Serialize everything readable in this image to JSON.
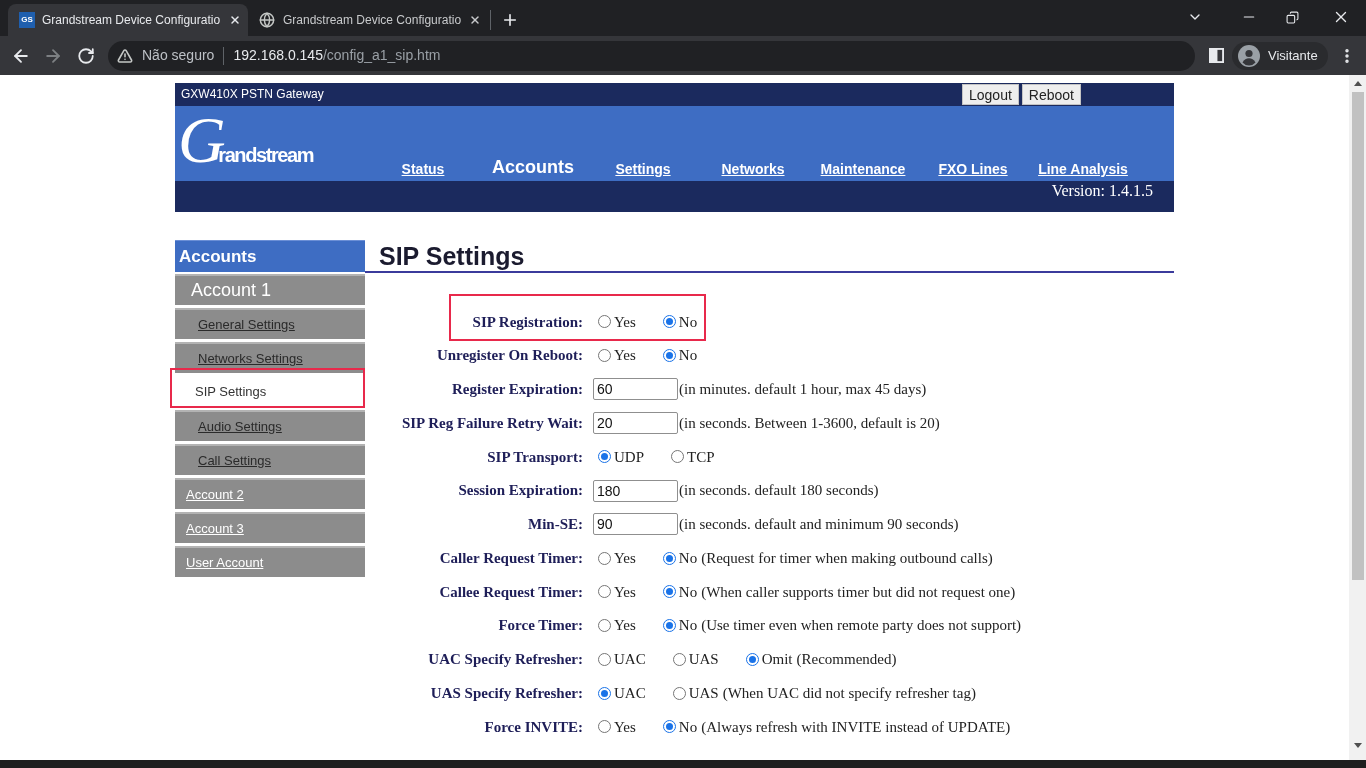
{
  "browser": {
    "tabs": [
      {
        "kind": "gs",
        "favicon_text": "GS",
        "title": "Grandstream Device Configuratio",
        "selected": true
      },
      {
        "kind": "globe",
        "title": "Grandstream Device Configuratio",
        "selected": false
      }
    ],
    "address_bar": {
      "security_label": "Não seguro",
      "host": "192.168.0.145",
      "path": "/config_a1_sip.htm"
    },
    "profile": {
      "label": "Visitante"
    }
  },
  "header": {
    "product": "GXW410X PSTN Gateway",
    "buttons": [
      "Logout",
      "Reboot"
    ],
    "logo": "Grandstream",
    "nav": [
      {
        "label": "Status",
        "selected": false
      },
      {
        "label": "Accounts",
        "selected": true
      },
      {
        "label": "Settings",
        "selected": false
      },
      {
        "label": "Networks",
        "selected": false
      },
      {
        "label": "Maintenance",
        "selected": false
      },
      {
        "label": "FXO Lines",
        "selected": false
      },
      {
        "label": "Line Analysis",
        "selected": false
      }
    ],
    "version": "Version: 1.4.1.5"
  },
  "sidebar": {
    "title": "Accounts",
    "items": [
      {
        "label": "Account 1",
        "expanded": true,
        "children": [
          {
            "label": "General Settings",
            "selected": false,
            "highlighted": false
          },
          {
            "label": "Networks Settings",
            "selected": false,
            "highlighted": false
          },
          {
            "label": "SIP Settings",
            "selected": true,
            "highlighted": true
          },
          {
            "label": "Audio Settings",
            "selected": false,
            "highlighted": false
          },
          {
            "label": "Call Settings",
            "selected": false,
            "highlighted": false
          }
        ]
      },
      {
        "label": "Account 2",
        "expanded": false
      },
      {
        "label": "Account 3",
        "expanded": false
      },
      {
        "label": "User Account",
        "expanded": false
      }
    ]
  },
  "main": {
    "title": "SIP Settings",
    "rows": [
      {
        "kind": "radio",
        "label": "SIP Registration:",
        "highlighted": true,
        "options": [
          {
            "label": "Yes",
            "selected": false
          },
          {
            "label": "No",
            "selected": true
          }
        ]
      },
      {
        "kind": "radio",
        "label": "Unregister On Reboot:",
        "highlighted": false,
        "options": [
          {
            "label": "Yes",
            "selected": false
          },
          {
            "label": "No",
            "selected": true
          }
        ]
      },
      {
        "kind": "text",
        "label": "Register Expiration:",
        "highlighted": false,
        "value": "60",
        "note": "(in minutes. default 1 hour, max 45 days)"
      },
      {
        "kind": "text",
        "label": "SIP Reg Failure Retry Wait:",
        "highlighted": false,
        "value": "20",
        "note": "(in seconds. Between 1-3600, default is 20)"
      },
      {
        "kind": "radio",
        "label": "SIP Transport:",
        "highlighted": false,
        "options": [
          {
            "label": "UDP",
            "selected": true
          },
          {
            "label": "TCP",
            "selected": false
          }
        ]
      },
      {
        "kind": "text",
        "label": "Session Expiration:",
        "highlighted": false,
        "value": "180",
        "note": "(in seconds. default 180 seconds)"
      },
      {
        "kind": "text",
        "label": "Min-SE:",
        "highlighted": false,
        "value": "90",
        "note": "(in seconds. default and minimum 90 seconds)"
      },
      {
        "kind": "radio",
        "label": "Caller Request Timer:",
        "highlighted": false,
        "options": [
          {
            "label": "Yes",
            "selected": false
          },
          {
            "label": "No",
            "selected": true
          }
        ],
        "note": "(Request for timer when making outbound calls)"
      },
      {
        "kind": "radio",
        "label": "Callee Request Timer:",
        "highlighted": false,
        "options": [
          {
            "label": "Yes",
            "selected": false
          },
          {
            "label": "No",
            "selected": true
          }
        ],
        "note": "(When caller supports timer but did not request one)"
      },
      {
        "kind": "radio",
        "label": "Force Timer:",
        "highlighted": false,
        "options": [
          {
            "label": "Yes",
            "selected": false
          },
          {
            "label": "No",
            "selected": true
          }
        ],
        "note": "(Use timer even when remote party does not support)"
      },
      {
        "kind": "radio",
        "label": "UAC Specify Refresher:",
        "highlighted": false,
        "options": [
          {
            "label": "UAC",
            "selected": false
          },
          {
            "label": "UAS",
            "selected": false
          },
          {
            "label": "Omit",
            "selected": true
          }
        ],
        "note": "(Recommended)"
      },
      {
        "kind": "radio",
        "label": "UAS Specify Refresher:",
        "highlighted": false,
        "options": [
          {
            "label": "UAC",
            "selected": true
          },
          {
            "label": "UAS",
            "selected": false
          }
        ],
        "note": "(When UAC did not specify refresher tag)"
      },
      {
        "kind": "radio",
        "label": "Force INVITE:",
        "highlighted": false,
        "options": [
          {
            "label": "Yes",
            "selected": false
          },
          {
            "label": "No",
            "selected": true
          }
        ],
        "note": "(Always refresh with INVITE instead of UPDATE)"
      }
    ]
  }
}
